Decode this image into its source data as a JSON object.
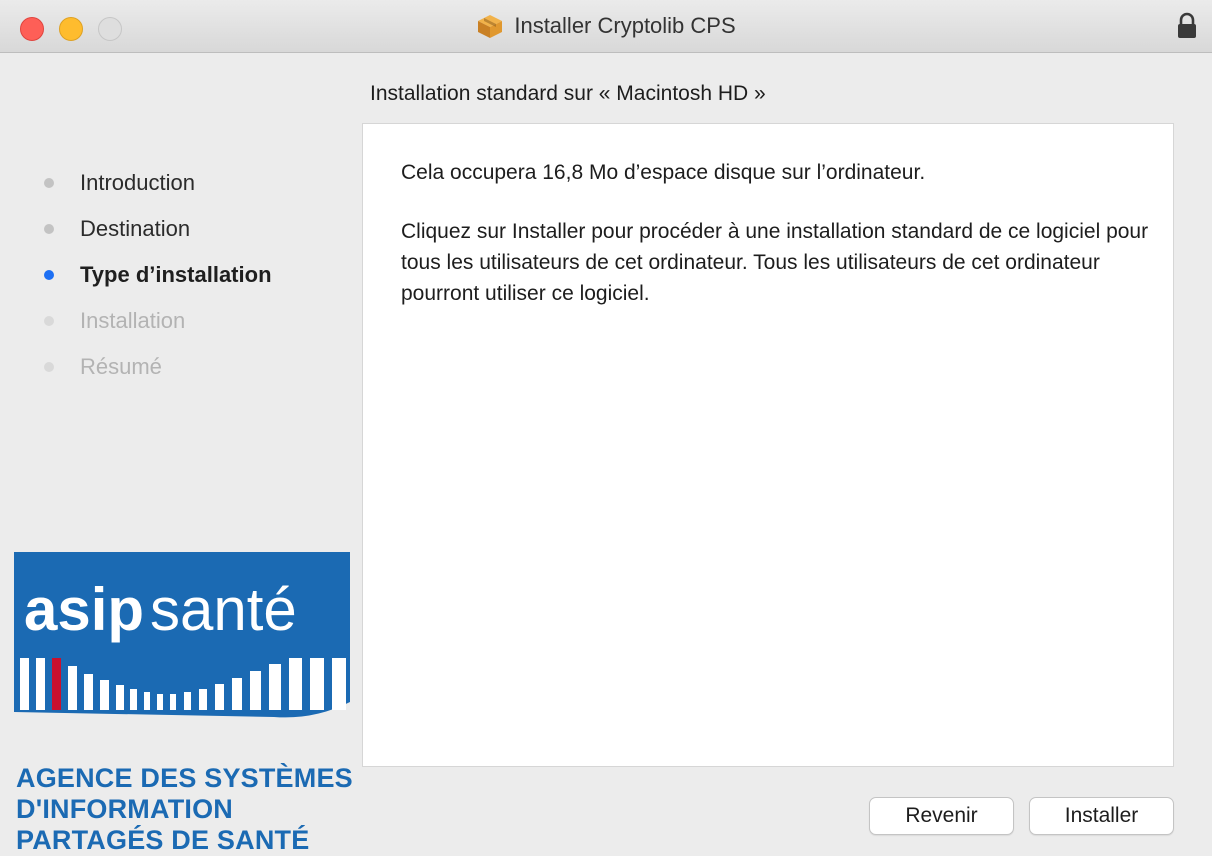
{
  "window": {
    "title": "Installer Cryptolib CPS",
    "icons": {
      "app": "package-icon",
      "lock": "lock-icon"
    },
    "traffic_lights": [
      "close",
      "minimize",
      "zoom"
    ]
  },
  "subtitle": "Installation standard sur « Macintosh HD »",
  "steps": [
    {
      "label": "Introduction",
      "state": "done"
    },
    {
      "label": "Destination",
      "state": "done"
    },
    {
      "label": "Type d’installation",
      "state": "current"
    },
    {
      "label": "Installation",
      "state": "pending"
    },
    {
      "label": "Résumé",
      "state": "pending"
    }
  ],
  "content": {
    "disk_usage": "Cela occupera 16,8 Mo d’espace disque sur l’ordinateur.",
    "description": "Cliquez sur Installer pour procéder à une installation standard de ce logiciel pour tous les utilisateurs de cet ordinateur. Tous les utilisateurs de cet ordinateur pourront utiliser ce logiciel."
  },
  "branding": {
    "logo_text": "asipsanté",
    "logo_bold": "asip",
    "logo_light": "santé",
    "agency_lines": [
      "AGENCE DES SYSTÈMES",
      "D'INFORMATION",
      "PARTAGÉS DE SANTÉ"
    ]
  },
  "buttons": {
    "back": "Revenir",
    "install": "Installer"
  },
  "colors": {
    "accent": "#1d6ff3",
    "brand_blue": "#1b6ab3",
    "brand_red": "#c8102e"
  }
}
